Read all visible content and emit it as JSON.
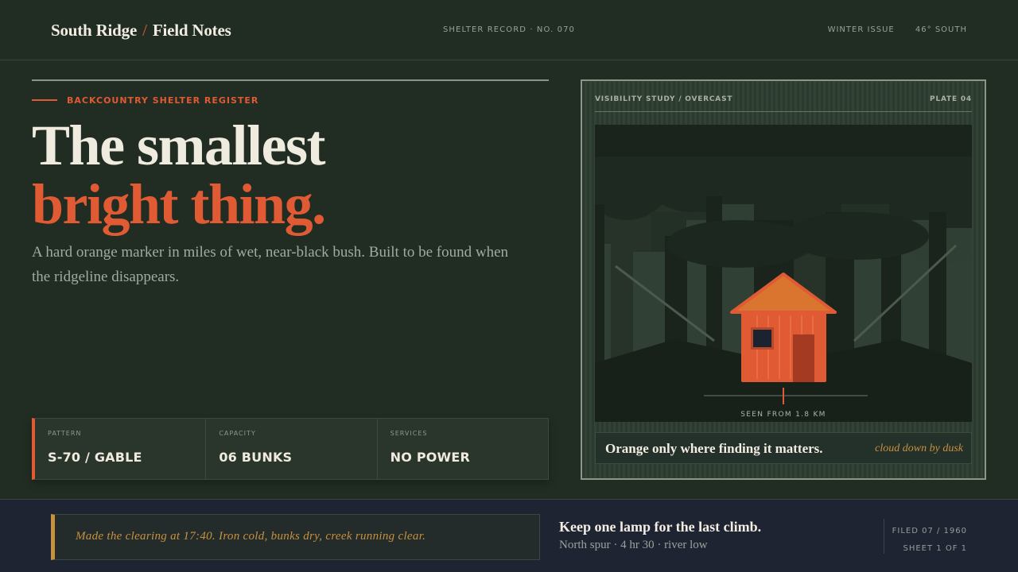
{
  "header": {
    "brand_primary": "South Ridge",
    "brand_separator": "/",
    "brand_secondary": "Field Notes",
    "record": "SHELTER RECORD · NO. 070",
    "issue": "WINTER ISSUE",
    "latitude": "46° SOUTH"
  },
  "hero": {
    "eyebrow": "BACKCOUNTRY SHELTER REGISTER",
    "headline_line1": "The smallest",
    "headline_line2": "bright thing.",
    "lede": "A hard orange marker in miles of wet, near-black bush. Built to be found when the ridgeline disappears."
  },
  "specs": [
    {
      "label": "PATTERN",
      "value": "S-70 / GABLE"
    },
    {
      "label": "CAPACITY",
      "value": "06 BUNKS"
    },
    {
      "label": "SERVICES",
      "value": "NO POWER"
    }
  ],
  "plate": {
    "title": "VISIBILITY STUDY / OVERCAST",
    "number": "PLATE 04",
    "distance_label": "SEEN FROM 1.8 KM",
    "caption": "Orange only where finding it matters.",
    "caption_note": "cloud down by dusk"
  },
  "footer": {
    "note": "Made the clearing at 17:40. Iron cold, bunks dry, creek running clear.",
    "title": "Keep one lamp for the last climb.",
    "subtitle": "North spur · 4 hr 30 · river low",
    "filed": "FILED 07 / 1960",
    "sheet": "SHEET 1 OF 1"
  },
  "colors": {
    "background": "#212c22",
    "accent_orange": "#e05a33",
    "accent_ochre": "#c7913f",
    "footer_navy": "#1f2432"
  }
}
